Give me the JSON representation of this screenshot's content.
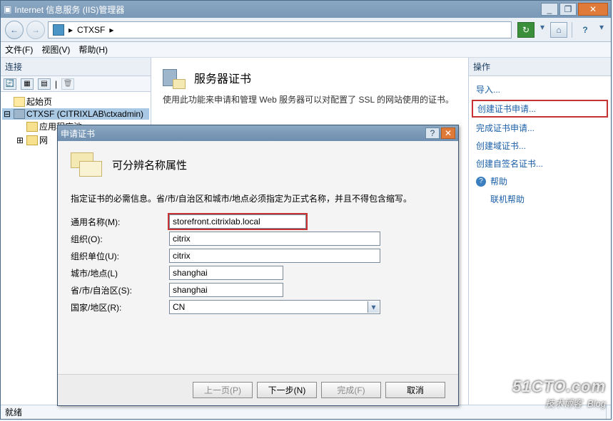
{
  "window": {
    "title": "Internet 信息服务 (IIS)管理器"
  },
  "sysbuttons": {
    "min": "_",
    "max": "❐",
    "close": "✕"
  },
  "nav": {
    "back": "←",
    "fwd": "→",
    "breadcrumb_sep": "▸",
    "breadcrumb": "CTXSF",
    "breadcrumb_tail": "▸",
    "refresh": "↻",
    "help": "?",
    "home": "⌂",
    "geardrop": "▾"
  },
  "menubar": {
    "file": "文件(F)",
    "view": "视图(V)",
    "help": "帮助(H)"
  },
  "leftpanel": {
    "heading": "连接",
    "toolbar": {
      "b1": "🔄",
      "b2": "▦",
      "b3": "▤",
      "b4": "|",
      "b5": "🗑"
    },
    "tree": {
      "root": "起始页",
      "server": "CTXSF (CITRIXLAB\\ctxadmin)",
      "apppool": "应用程序池",
      "sites": "网"
    }
  },
  "middle": {
    "title": "服务器证书",
    "desc": "使用此功能来申请和管理 Web 服务器可以对配置了 SSL 的网站使用的证书。"
  },
  "actions": {
    "heading": "操作",
    "items": {
      "import": "导入...",
      "create_req": "创建证书申请...",
      "complete_req": "完成证书申请...",
      "create_domain": "创建域证书...",
      "create_self": "创建自签名证书...",
      "help": "帮助",
      "online": "联机帮助"
    }
  },
  "dialog": {
    "title": "申请证书",
    "heading": "可分辨名称属性",
    "desc": "指定证书的必需信息。省/市/自治区和城市/地点必须指定为正式名称，并且不得包含缩写。",
    "labels": {
      "cn": "通用名称(M):",
      "org": "组织(O):",
      "ou": "组织单位(U):",
      "city": "城市/地点(L)",
      "state": "省/市/自治区(S):",
      "country": "国家/地区(R):"
    },
    "values": {
      "cn": "storefront.citrixlab.local",
      "org": "citrix",
      "ou": "citrix",
      "city": "shanghai",
      "state": "shanghai",
      "country": "CN"
    },
    "buttons": {
      "prev": "上一页(P)",
      "next": "下一步(N)",
      "finish": "完成(F)",
      "cancel": "取消"
    },
    "qmark": "?",
    "close": "✕"
  },
  "statusbar": {
    "text": "就绪"
  },
  "watermark": {
    "l1": "51CTO.com",
    "l2": "技术博客",
    "l3": "Blog"
  }
}
